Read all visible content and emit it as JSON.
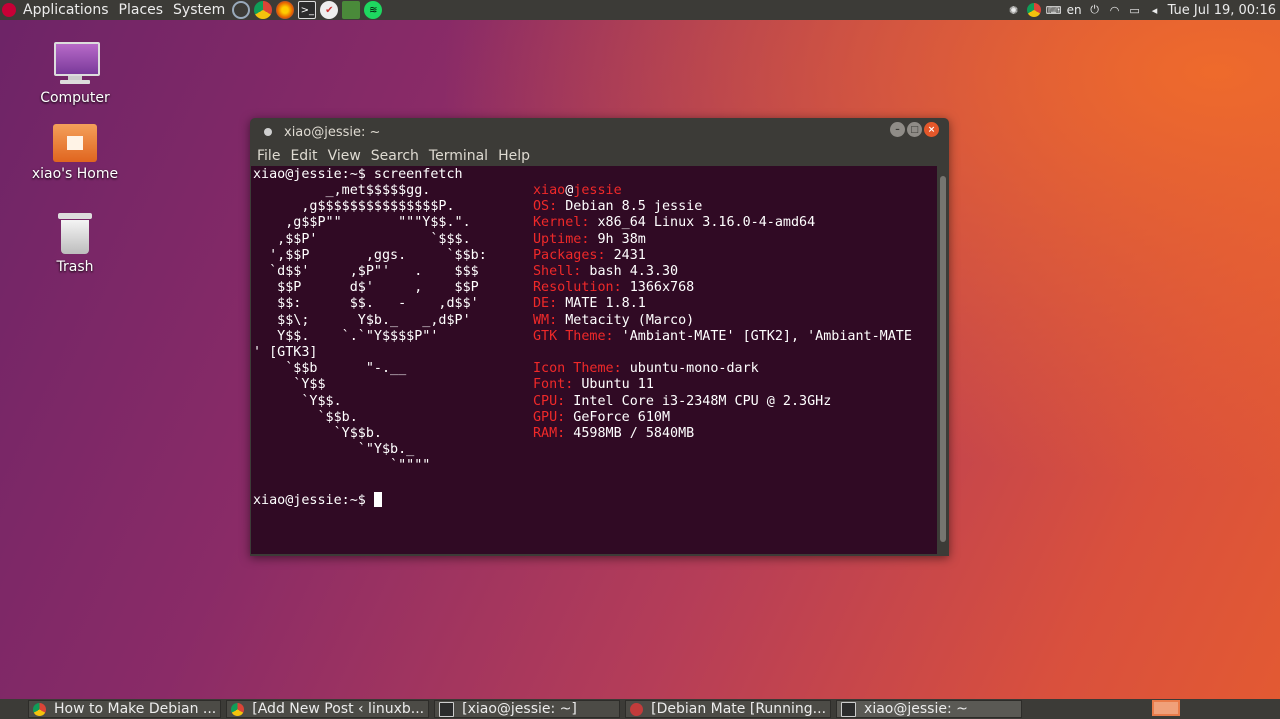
{
  "top_panel": {
    "menus": [
      "Applications",
      "Places",
      "System"
    ],
    "tray": {
      "lang": "en",
      "clock": "Tue Jul 19, 00:16"
    }
  },
  "desktop_icons": [
    {
      "label": "Computer"
    },
    {
      "label": "xiao's Home"
    },
    {
      "label": "Trash"
    }
  ],
  "terminal": {
    "title": "xiao@jessie: ~",
    "menu": [
      "File",
      "Edit",
      "View",
      "Search",
      "Terminal",
      "Help"
    ],
    "command_line": "xiao@jessie:~$ screenfetch",
    "prompt": "xiao@jessie:~$ ",
    "logo": [
      "         _,met$$$$$gg.",
      "      ,g$$$$$$$$$$$$$$$P.",
      "    ,g$$P\"\"       \"\"\"Y$$.\".",
      "   ,$$P'              `$$$.",
      "  ',$$P       ,ggs.     `$$b:",
      "  `d$$'     ,$P\"'   .    $$$",
      "   $$P      d$'     ,    $$P",
      "   $$:      $$.   -    ,d$$'",
      "   $$\\;      Y$b._   _,d$P'",
      "   Y$$.    `.`\"Y$$$$P\"'",
      "",
      "    `$$b      \"-.__",
      "     `Y$$",
      "      `Y$$.",
      "        `$$b.",
      "          `Y$$b.",
      "             `\"Y$b._",
      "                 `\"\"\"\""
    ],
    "userhost": {
      "user": "xiao",
      "at": "@",
      "host": "jessie"
    },
    "info": [
      {
        "k": "OS:",
        "v": " Debian 8.5 jessie"
      },
      {
        "k": "Kernel:",
        "v": " x86_64 Linux 3.16.0-4-amd64"
      },
      {
        "k": "Uptime:",
        "v": " 9h 38m"
      },
      {
        "k": "Packages:",
        "v": " 2431"
      },
      {
        "k": "Shell:",
        "v": " bash 4.3.30"
      },
      {
        "k": "Resolution:",
        "v": " 1366x768"
      },
      {
        "k": "DE:",
        "v": " MATE 1.8.1"
      },
      {
        "k": "WM:",
        "v": " Metacity (Marco)"
      },
      {
        "k": "GTK Theme:",
        "v": " 'Ambiant-MATE' [GTK2], 'Ambiant-MATE"
      },
      {
        "k": "Icon Theme:",
        "v": " ubuntu-mono-dark"
      },
      {
        "k": "Font:",
        "v": " Ubuntu 11"
      },
      {
        "k": "CPU:",
        "v": " Intel Core i3-2348M CPU @ 2.3GHz"
      },
      {
        "k": "GPU:",
        "v": " GeForce 610M"
      },
      {
        "k": "RAM:",
        "v": " 4598MB / 5840MB"
      }
    ],
    "wrap_line": "' [GTK3]"
  },
  "taskbar": [
    {
      "label": "How to Make Debian ...",
      "icon": "chrome-icon"
    },
    {
      "label": "[Add New Post ‹ linuxb...",
      "icon": "chrome-icon"
    },
    {
      "label": "[xiao@jessie: ~]",
      "icon": "terminal-icon"
    },
    {
      "label": "[Debian Mate [Running...",
      "icon": "virtualbox-icon"
    },
    {
      "label": "xiao@jessie: ~",
      "icon": "terminal-icon"
    }
  ],
  "colors": {
    "accent_red": "#ef2929",
    "terminal_bg": "#300a24",
    "panel_bg": "#3c3b37"
  }
}
